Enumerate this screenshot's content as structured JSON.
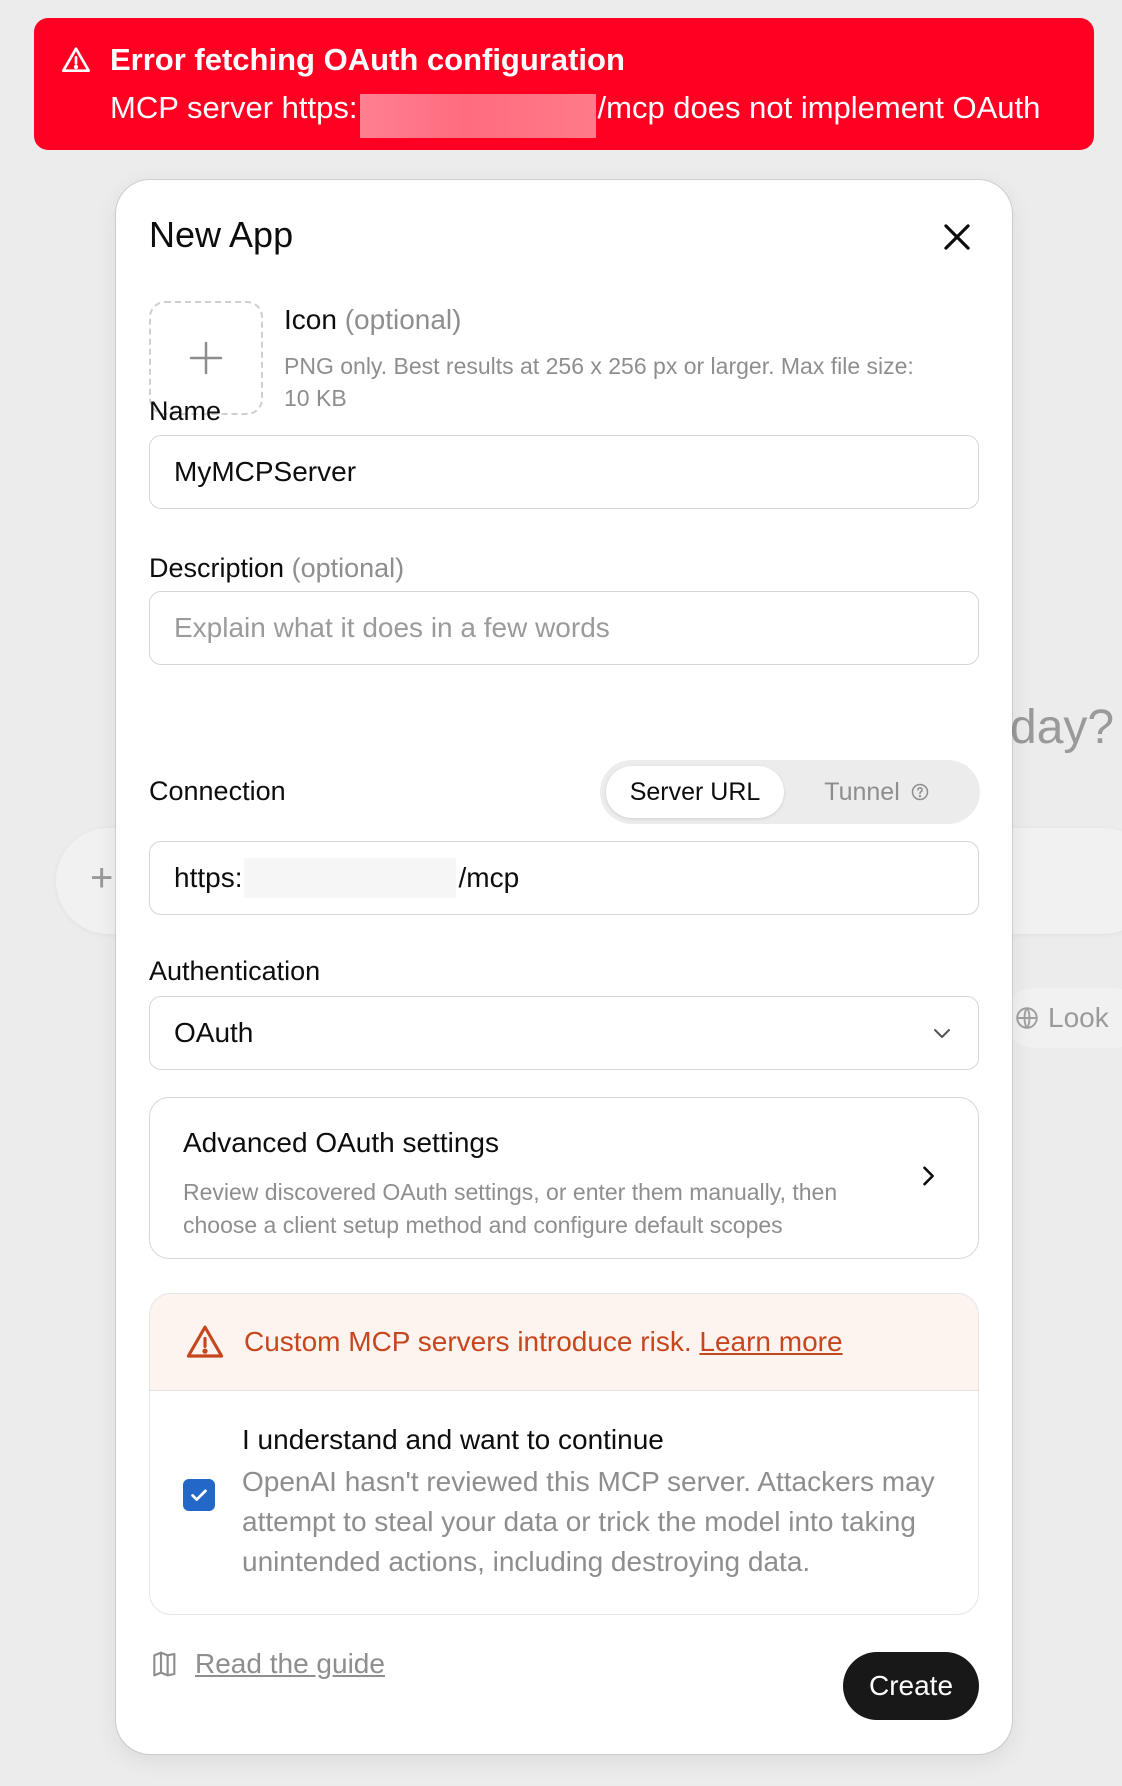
{
  "background": {
    "partial_heading": "day?",
    "partial_pill": "Look"
  },
  "toast": {
    "title": "Error fetching OAuth configuration",
    "message_prefix": "MCP server https:",
    "message_suffix": "/mcp does not implement OAuth",
    "color": "#ff0022"
  },
  "modal": {
    "title": "New App",
    "icon": {
      "label": "Icon",
      "optional": "(optional)",
      "help": "PNG only. Best results at 256 x 256 px or larger. Max file size: 10 KB"
    },
    "name": {
      "label": "Name",
      "value": "MyMCPServer"
    },
    "description": {
      "label": "Description",
      "optional": "(optional)",
      "placeholder": "Explain what it does in a few words"
    },
    "connection": {
      "label": "Connection",
      "options": [
        "Server URL",
        "Tunnel"
      ],
      "selected": "Server URL",
      "url_prefix": "https:",
      "url_suffix": "/mcp"
    },
    "authentication": {
      "label": "Authentication",
      "value": "OAuth"
    },
    "advanced": {
      "title": "Advanced OAuth settings",
      "description": "Review discovered OAuth settings, or enter them manually, then choose a client setup method and configure default scopes"
    },
    "risk": {
      "warning": "Custom MCP servers introduce risk.",
      "link": "Learn more",
      "ack_title": "I understand and want to continue",
      "ack_desc": "OpenAI hasn't reviewed this MCP server. Attackers may attempt to steal your data or trick the model into taking unintended actions, including destroying data.",
      "checked": true,
      "accent": "#c6471e",
      "checkbox_color": "#2367c8"
    },
    "footer": {
      "guide": "Read the guide",
      "create": "Create"
    }
  }
}
